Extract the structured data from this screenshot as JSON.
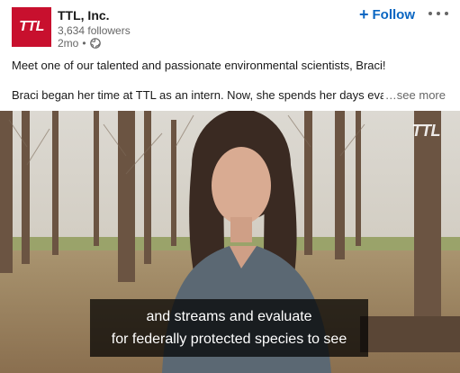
{
  "company": {
    "logo_text": "TTL",
    "name": "TTL, Inc.",
    "followers": "3,634 followers",
    "posted": "2mo",
    "separator": "•",
    "visibility_icon": "globe-icon"
  },
  "actions": {
    "follow_label": "Follow",
    "follow_icon": "plus-icon",
    "more_icon": "ellipsis-icon"
  },
  "post": {
    "line1": "Meet one of our talented and passionate environmental scientists, Braci!",
    "line2": "Braci began her time at TTL as an intern. Now, she spends her days eva",
    "see_more": "…see more"
  },
  "video": {
    "watermark": "TTL",
    "caption_line1": "and streams and evaluate",
    "caption_line2": "for federally protected species to see"
  },
  "colors": {
    "brand_red": "#c8102e",
    "link_blue": "#0a66c2",
    "muted_text": "#666666"
  }
}
